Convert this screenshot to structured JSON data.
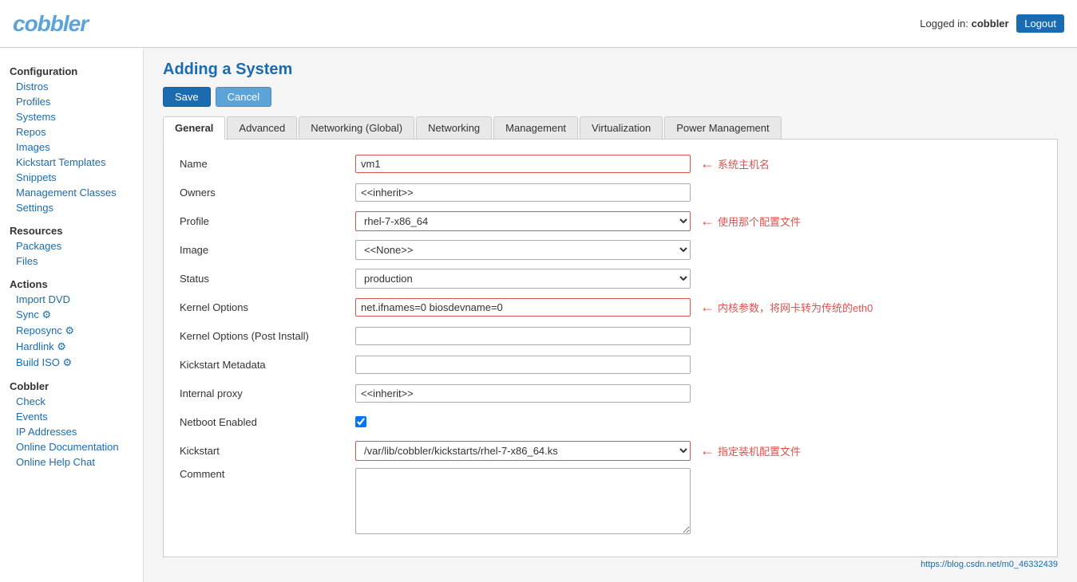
{
  "header": {
    "logo": "cobbler",
    "logged_in_label": "Logged in:",
    "username": "cobbler",
    "logout_label": "Logout"
  },
  "sidebar": {
    "configuration": {
      "title": "Configuration",
      "items": [
        {
          "label": "Distros",
          "icon": false
        },
        {
          "label": "Profiles",
          "icon": false
        },
        {
          "label": "Systems",
          "icon": false
        },
        {
          "label": "Repos",
          "icon": false
        },
        {
          "label": "Images",
          "icon": false
        },
        {
          "label": "Kickstart Templates",
          "icon": false
        },
        {
          "label": "Snippets",
          "icon": false
        },
        {
          "label": "Management Classes",
          "icon": false
        },
        {
          "label": "Settings",
          "icon": false
        }
      ]
    },
    "resources": {
      "title": "Resources",
      "items": [
        {
          "label": "Packages",
          "icon": false
        },
        {
          "label": "Files",
          "icon": false
        }
      ]
    },
    "actions": {
      "title": "Actions",
      "items": [
        {
          "label": "Import DVD",
          "icon": false
        },
        {
          "label": "Sync",
          "icon": true
        },
        {
          "label": "Reposync",
          "icon": true
        },
        {
          "label": "Hardlink",
          "icon": true
        },
        {
          "label": "Build ISO",
          "icon": true
        }
      ]
    },
    "cobbler": {
      "title": "Cobbler",
      "items": [
        {
          "label": "Check",
          "icon": false
        },
        {
          "label": "Events",
          "icon": false
        },
        {
          "label": "IP Addresses",
          "icon": false
        },
        {
          "label": "Online Documentation",
          "icon": false
        },
        {
          "label": "Online Help Chat",
          "icon": false
        }
      ]
    }
  },
  "page": {
    "title": "Adding a System",
    "save_label": "Save",
    "cancel_label": "Cancel"
  },
  "tabs": [
    {
      "label": "General",
      "active": true
    },
    {
      "label": "Advanced",
      "active": false
    },
    {
      "label": "Networking (Global)",
      "active": false
    },
    {
      "label": "Networking",
      "active": false
    },
    {
      "label": "Management",
      "active": false
    },
    {
      "label": "Virtualization",
      "active": false
    },
    {
      "label": "Power Management",
      "active": false
    }
  ],
  "form": {
    "fields": [
      {
        "label": "Name",
        "type": "input",
        "value": "vm1",
        "highlight": true,
        "annotation": "系统主机名"
      },
      {
        "label": "Owners",
        "type": "input",
        "value": "<<inherit>>",
        "highlight": false,
        "annotation": ""
      },
      {
        "label": "Profile",
        "type": "select",
        "value": "rhel-7-x86_64",
        "highlight": true,
        "annotation": "使用那个配置文件",
        "options": [
          "rhel-7-x86_64"
        ]
      },
      {
        "label": "Image",
        "type": "select",
        "value": "<<None>>",
        "highlight": false,
        "annotation": "",
        "options": [
          "<<None>>"
        ]
      },
      {
        "label": "Status",
        "type": "select",
        "value": "production",
        "highlight": false,
        "annotation": "",
        "options": [
          "production"
        ]
      },
      {
        "label": "Kernel Options",
        "type": "input",
        "value": "net.ifnames=0 biosdevname=0",
        "highlight": true,
        "annotation": "内核参数，将网卡转为传统的eth0"
      },
      {
        "label": "Kernel Options (Post Install)",
        "type": "input",
        "value": "",
        "highlight": false,
        "annotation": ""
      },
      {
        "label": "Kickstart Metadata",
        "type": "input",
        "value": "",
        "highlight": false,
        "annotation": ""
      },
      {
        "label": "Internal proxy",
        "type": "input",
        "value": "<<inherit>>",
        "highlight": false,
        "annotation": ""
      },
      {
        "label": "Netboot Enabled",
        "type": "checkbox",
        "value": true,
        "highlight": false,
        "annotation": ""
      },
      {
        "label": "Kickstart",
        "type": "select",
        "value": "/var/lib/cobbler/kickstarts/rhel-7-x86_64.ks",
        "highlight": true,
        "annotation": "指定装机配置文件",
        "options": [
          "/var/lib/cobbler/kickstarts/rhel-7-x86_64.ks"
        ]
      },
      {
        "label": "Comment",
        "type": "textarea",
        "value": "",
        "highlight": false,
        "annotation": ""
      }
    ]
  },
  "footer": {
    "watermark": "https://blog.csdn.net/m0_46332439"
  }
}
